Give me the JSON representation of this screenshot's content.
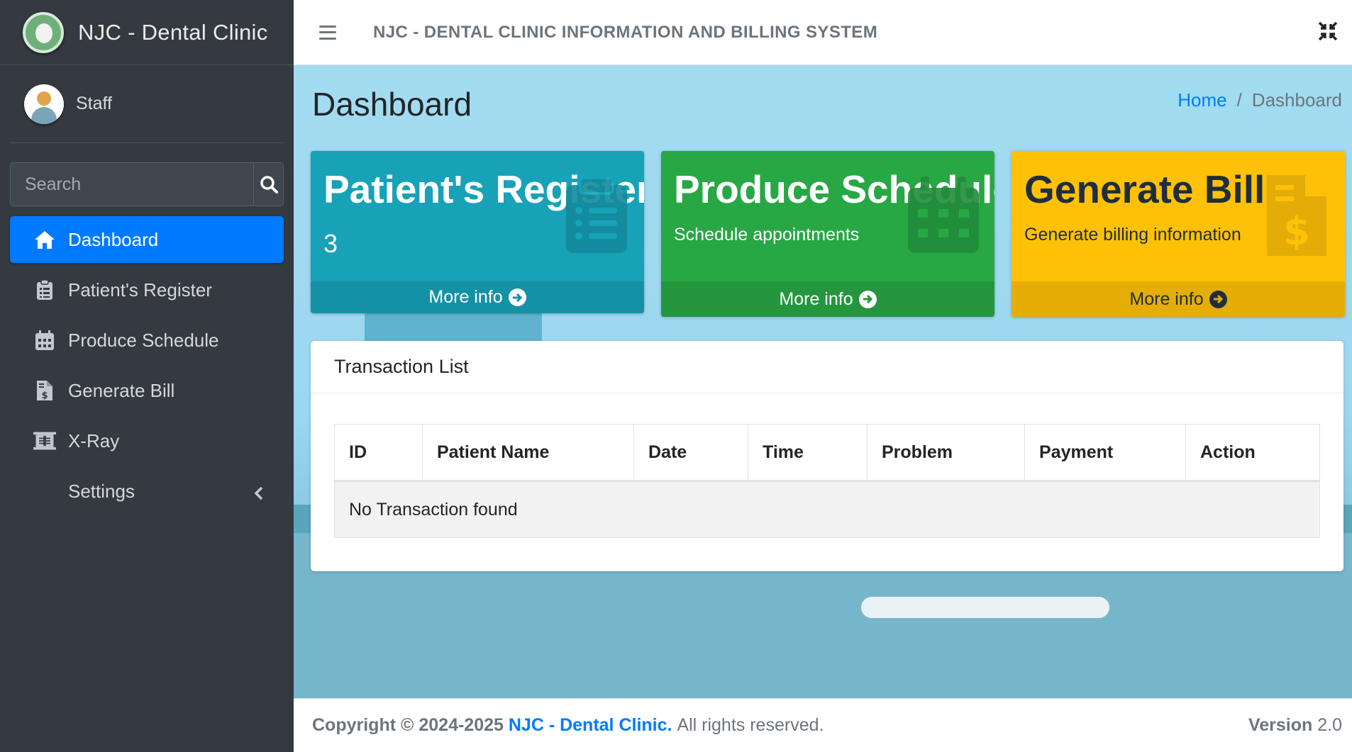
{
  "brand": {
    "name": "NJC - Dental Clinic"
  },
  "user": {
    "name": "Staff"
  },
  "search": {
    "placeholder": "Search"
  },
  "sidebar": {
    "items": [
      {
        "label": "Dashboard",
        "icon": "home-icon",
        "active": true
      },
      {
        "label": "Patient's Register",
        "icon": "clipboard-list-icon"
      },
      {
        "label": "Produce Schedule",
        "icon": "calendar-icon"
      },
      {
        "label": "Generate Bill",
        "icon": "file-invoice-dollar-icon"
      },
      {
        "label": "X-Ray",
        "icon": "x-ray-icon"
      },
      {
        "label": "Settings",
        "icon": "chevron-left-icon"
      }
    ]
  },
  "header": {
    "title": "NJC - DENTAL CLINIC INFORMATION AND BILLING SYSTEM"
  },
  "page": {
    "title": "Dashboard",
    "breadcrumb": {
      "home": "Home",
      "separator": "/",
      "current": "Dashboard"
    }
  },
  "boxes": [
    {
      "title": "Patient's Register",
      "value": "3",
      "more": "More info",
      "color": "#17a2b8"
    },
    {
      "title": "Produce Schedule",
      "subtitle": "Schedule appointments",
      "more": "More info",
      "color": "#28a745"
    },
    {
      "title": "Generate Bill",
      "subtitle": "Generate billing information",
      "more": "More info",
      "color": "#ffc107"
    }
  ],
  "transactions": {
    "title": "Transaction List",
    "columns": [
      "ID",
      "Patient Name",
      "Date",
      "Time",
      "Problem",
      "Payment",
      "Action"
    ],
    "empty": "No Transaction found"
  },
  "footer": {
    "copyright": "Copyright © 2024-2025",
    "clinic": "NJC - Dental Clinic.",
    "rights": "All rights reserved.",
    "version_label": "Version",
    "version": "2.0"
  },
  "colors": {
    "accent": "#007bff",
    "sidebar": "#343a40"
  }
}
